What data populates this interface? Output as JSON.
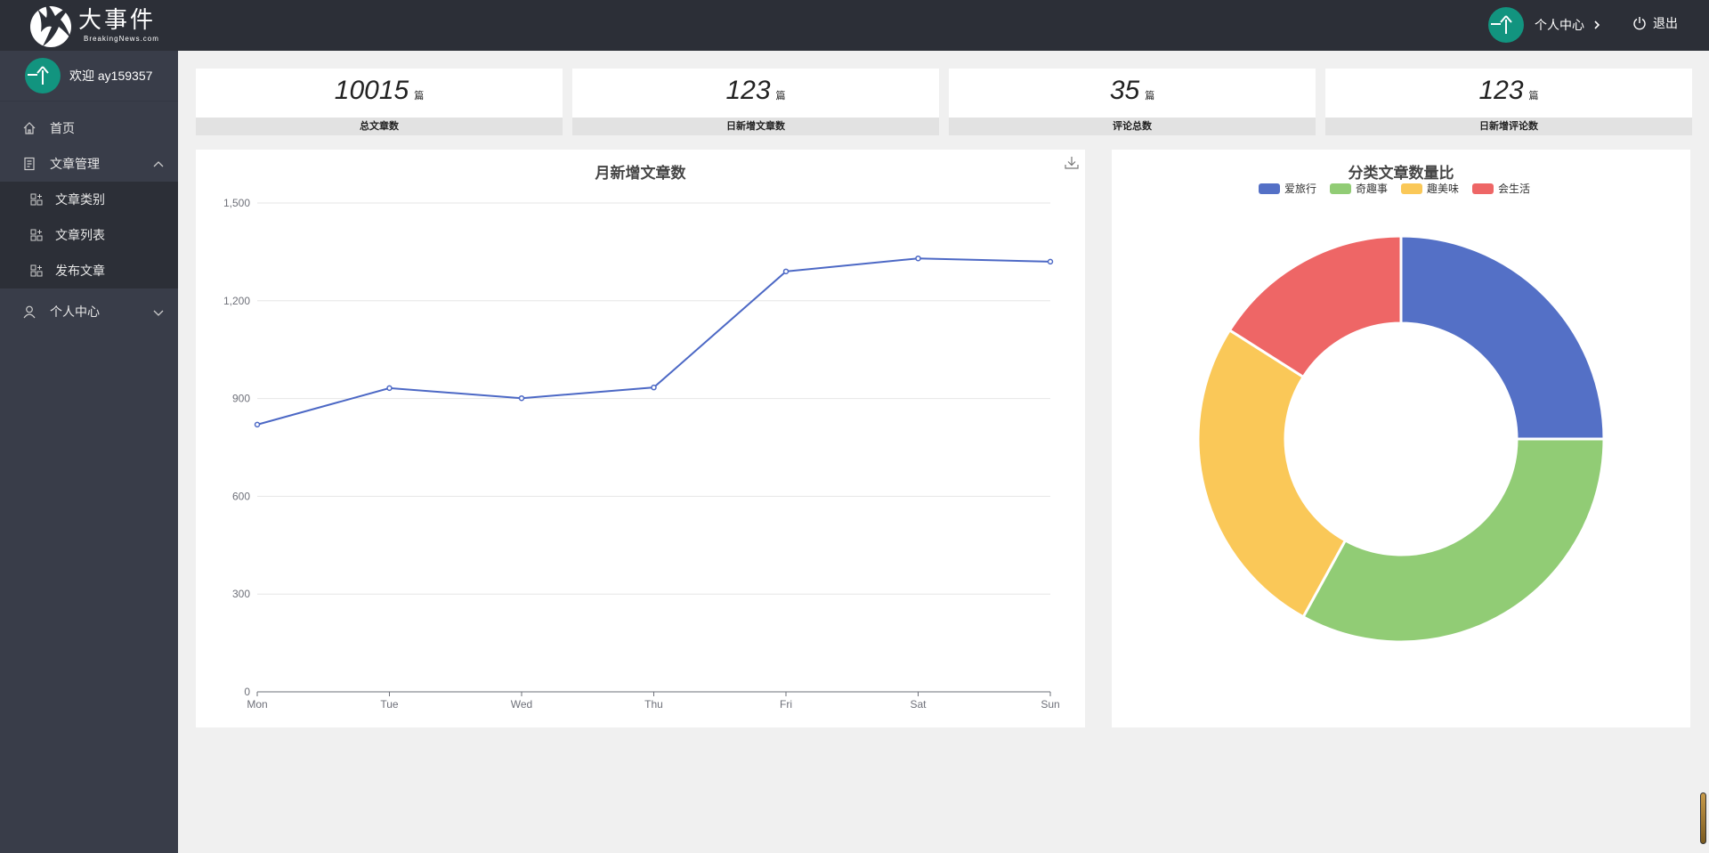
{
  "app": {
    "logo_title": "大事件",
    "logo_sub": "BreakingNews.com"
  },
  "header": {
    "user_center": "个人中心",
    "logout": "退出"
  },
  "sidebar": {
    "welcome": "欢迎",
    "username": "ay159357",
    "items": [
      {
        "label": "首页",
        "icon": "home-icon"
      },
      {
        "label": "文章管理",
        "icon": "document-icon"
      },
      {
        "label": "个人中心",
        "icon": "user-icon"
      }
    ],
    "sub_items": [
      {
        "label": "文章类别",
        "icon": "grid-plus-icon"
      },
      {
        "label": "文章列表",
        "icon": "grid-plus-icon"
      },
      {
        "label": "发布文章",
        "icon": "grid-plus-icon"
      }
    ]
  },
  "stats": [
    {
      "value": "10015",
      "unit": "篇",
      "label": "总文章数"
    },
    {
      "value": "123",
      "unit": "篇",
      "label": "日新增文章数"
    },
    {
      "value": "35",
      "unit": "篇",
      "label": "评论总数"
    },
    {
      "value": "123",
      "unit": "篇",
      "label": "日新增评论数"
    }
  ],
  "colors": {
    "header_bg": "#2c2f37",
    "sidebar_bg": "#393d49",
    "accent": "#12947f",
    "line": "#4c68c5"
  },
  "chart_data": [
    {
      "type": "line",
      "title": "月新增文章数",
      "categories": [
        "Mon",
        "Tue",
        "Wed",
        "Thu",
        "Fri",
        "Sat",
        "Sun"
      ],
      "values": [
        820,
        932,
        901,
        934,
        1290,
        1330,
        1320
      ],
      "ylim": [
        0,
        1500
      ],
      "yticks": [
        "0",
        "300",
        "600",
        "900",
        "1,200",
        "1,500"
      ],
      "grid": true
    },
    {
      "type": "pie",
      "title": "分类文章数量比",
      "legend_position": "top",
      "slices": [
        {
          "name": "爱旅行",
          "value": 25,
          "color": "#5470c6"
        },
        {
          "name": "奇趣事",
          "value": 33,
          "color": "#91cc75"
        },
        {
          "name": "趣美味",
          "value": 26,
          "color": "#fac858"
        },
        {
          "name": "会生活",
          "value": 16,
          "color": "#ee6666"
        }
      ]
    }
  ]
}
